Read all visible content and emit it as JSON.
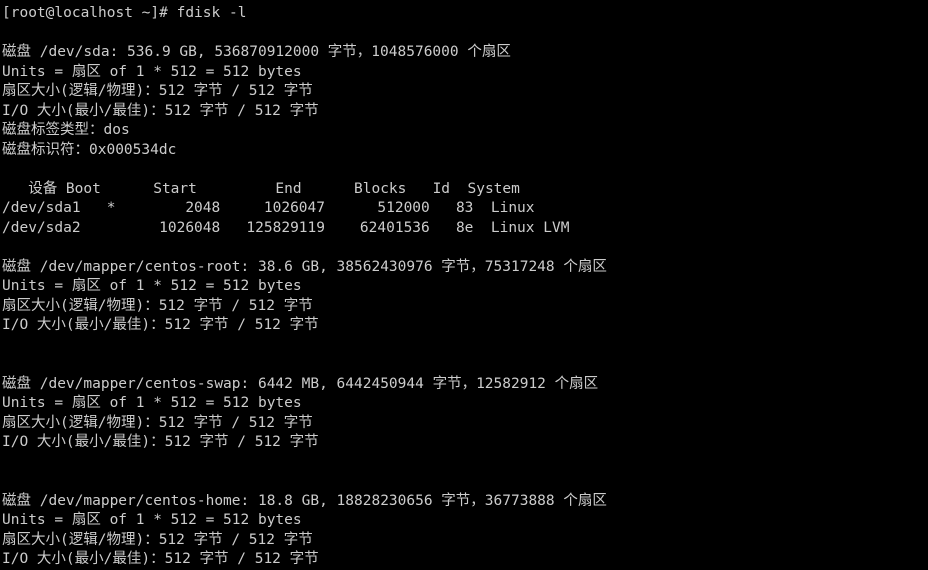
{
  "terminal": {
    "window_kind": "linux-console",
    "colors": {
      "background": "#000000",
      "foreground": "#cccccc"
    },
    "prompt": "[root@localhost ~]# ",
    "command": "fdisk -l",
    "lines": [
      "[root@localhost ~]# fdisk -l",
      "",
      "磁盘 /dev/sda: 536.9 GB, 536870912000 字节，1048576000 个扇区",
      "Units = 扇区 of 1 * 512 = 512 bytes",
      "扇区大小(逻辑/物理)：512 字节 / 512 字节",
      "I/O 大小(最小/最佳)：512 字节 / 512 字节",
      "磁盘标签类型：dos",
      "磁盘标识符：0x000534dc",
      "",
      "   设备 Boot      Start         End      Blocks   Id  System",
      "/dev/sda1   *        2048     1026047      512000   83  Linux",
      "/dev/sda2         1026048   125829119    62401536   8e  Linux LVM",
      "",
      "磁盘 /dev/mapper/centos-root: 38.6 GB, 38562430976 字节，75317248 个扇区",
      "Units = 扇区 of 1 * 512 = 512 bytes",
      "扇区大小(逻辑/物理)：512 字节 / 512 字节",
      "I/O 大小(最小/最佳)：512 字节 / 512 字节",
      "",
      "",
      "磁盘 /dev/mapper/centos-swap: 6442 MB, 6442450944 字节，12582912 个扇区",
      "Units = 扇区 of 1 * 512 = 512 bytes",
      "扇区大小(逻辑/物理)：512 字节 / 512 字节",
      "I/O 大小(最小/最佳)：512 字节 / 512 字节",
      "",
      "",
      "磁盘 /dev/mapper/centos-home: 18.8 GB, 18828230656 字节，36773888 个扇区",
      "Units = 扇区 of 1 * 512 = 512 bytes",
      "扇区大小(逻辑/物理)：512 字节 / 512 字节",
      "I/O 大小(最小/最佳)：512 字节 / 512 字节"
    ],
    "partition_table": {
      "headers": [
        "设备",
        "Boot",
        "Start",
        "End",
        "Blocks",
        "Id",
        "System"
      ],
      "rows": [
        {
          "device": "/dev/sda1",
          "boot": "*",
          "start": "2048",
          "end": "1026047",
          "blocks": "512000",
          "id": "83",
          "system": "Linux"
        },
        {
          "device": "/dev/sda2",
          "boot": "",
          "start": "1026048",
          "end": "125829119",
          "blocks": "62401536",
          "id": "8e",
          "system": "Linux LVM"
        }
      ]
    },
    "disks": [
      {
        "name": "/dev/sda",
        "size_human": "536.9 GB",
        "size_bytes": "536870912000",
        "sectors": "1048576000",
        "units": "扇区 of 1 * 512 = 512 bytes",
        "sector_size": "512 字节 / 512 字节",
        "io_size": "512 字节 / 512 字节",
        "label_type": "dos",
        "identifier": "0x000534dc"
      },
      {
        "name": "/dev/mapper/centos-root",
        "size_human": "38.6 GB",
        "size_bytes": "38562430976",
        "sectors": "75317248",
        "units": "扇区 of 1 * 512 = 512 bytes",
        "sector_size": "512 字节 / 512 字节",
        "io_size": "512 字节 / 512 字节"
      },
      {
        "name": "/dev/mapper/centos-swap",
        "size_human": "6442 MB",
        "size_bytes": "6442450944",
        "sectors": "12582912",
        "units": "扇区 of 1 * 512 = 512 bytes",
        "sector_size": "512 字节 / 512 字节",
        "io_size": "512 字节 / 512 字节"
      },
      {
        "name": "/dev/mapper/centos-home",
        "size_human": "18.8 GB",
        "size_bytes": "18828230656",
        "sectors": "36773888",
        "units": "扇区 of 1 * 512 = 512 bytes",
        "sector_size": "512 字节 / 512 字节",
        "io_size": "512 字节 / 512 字节"
      }
    ]
  }
}
